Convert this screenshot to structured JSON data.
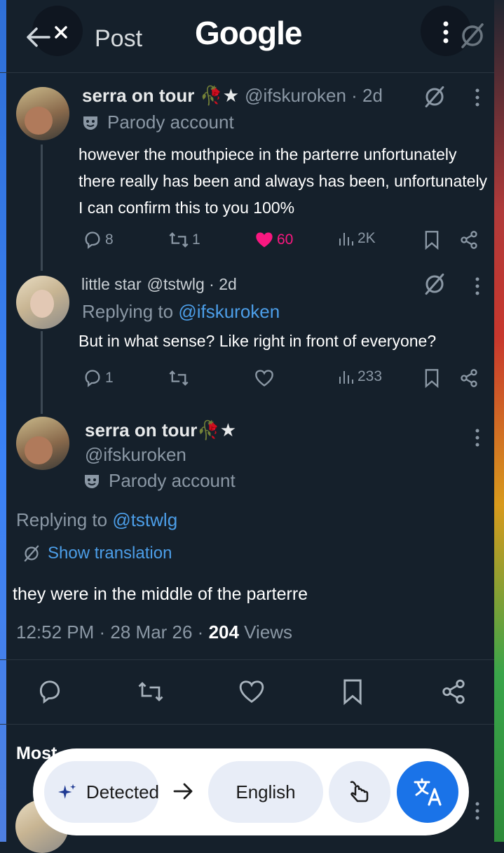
{
  "header": {
    "title": "Post",
    "overlay_brand": "Google"
  },
  "tweets": [
    {
      "display_name": "serra on tour",
      "name_suffix": "🥀★",
      "handle_time": "@ifskuroken · 2d",
      "badge": "Parody account",
      "text_lines": [
        "however the mouthpiece in the parterre unfortunately",
        "there really has been and always has been, unfortunately",
        "I can confirm this to you 100%"
      ],
      "replies": "8",
      "reposts": "1",
      "likes": "60",
      "views": "2K"
    },
    {
      "display_name": "little star",
      "handle_time": "@tstwlg · 2d",
      "replying_prefix": "Replying to ",
      "replying_handle": "@ifskuroken",
      "text": "But in what sense? Like right in front of everyone?",
      "replies": "1",
      "views": "233"
    }
  ],
  "main": {
    "display_name": "serra on tour",
    "name_suffix": "🥀★",
    "handle": "@ifskuroken",
    "badge": "Parody account",
    "replying_prefix": "Replying to ",
    "replying_handle": "@tstwlg",
    "translation_label": "Show translation",
    "text": "they were in the middle of the parterre",
    "time": "12:52 PM · 28 Mar 26 · ",
    "views_count": "204",
    "views_label": " Views"
  },
  "section": {
    "partial_heading": "Most"
  },
  "translate_bar": {
    "source": "Detected",
    "target": "English"
  },
  "colors": {
    "bg": "#15202b",
    "link": "#4c9ee8",
    "like": "#f91880",
    "translate": "#1a73e8"
  },
  "icons": [
    "back-arrow-icon",
    "close-icon",
    "more-vertical-icon",
    "grok-icon",
    "reply-icon",
    "repost-icon",
    "heart-icon",
    "views-icon",
    "bookmark-icon",
    "share-icon",
    "sparkle-icon",
    "arrow-right-icon",
    "tap-icon",
    "translate-icon"
  ]
}
